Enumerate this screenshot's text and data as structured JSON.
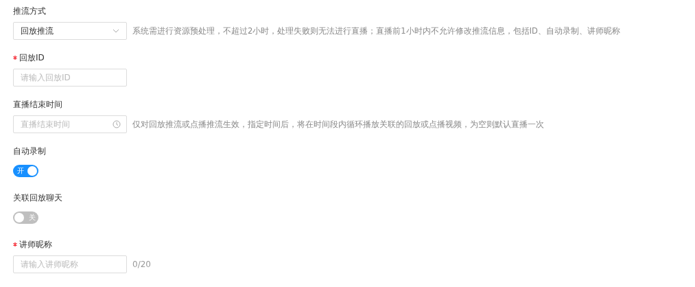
{
  "fields": [
    {
      "kind": "select",
      "label": "推流方式",
      "required": false,
      "value": "回放推流",
      "hint": "系统需进行资源预处理，不超过2小时，处理失败则无法进行直播；直播前1小时内不允许修改推流信息，包括ID、自动录制、讲师昵称"
    },
    {
      "kind": "input",
      "label": "回放ID",
      "required": true,
      "placeholder": "请输入回放ID"
    },
    {
      "kind": "time",
      "label": "直播结束时间",
      "required": false,
      "placeholder": "直播结束时间",
      "hint": "仅对回放推流或点播推流生效，指定时间后，将在时间段内循环播放关联的回放或点播视频，为空则默认直播一次"
    },
    {
      "kind": "switch",
      "label": "自动录制",
      "required": false,
      "on": true,
      "text": "开"
    },
    {
      "kind": "switch",
      "label": "关联回放聊天",
      "required": false,
      "on": false,
      "text": "关"
    },
    {
      "kind": "input",
      "label": "讲师昵称",
      "required": true,
      "placeholder": "请输入讲师昵称",
      "counter": "0/20"
    }
  ]
}
